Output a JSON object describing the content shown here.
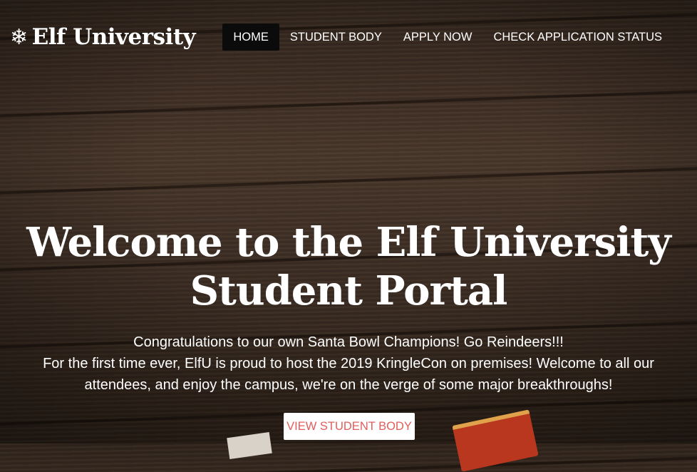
{
  "brand": {
    "icon": "snowflake-icon",
    "glyph": "❄",
    "name": "Elf University"
  },
  "nav": {
    "items": [
      {
        "label": "HOME",
        "active": true
      },
      {
        "label": "STUDENT BODY",
        "active": false
      },
      {
        "label": "APPLY NOW",
        "active": false
      },
      {
        "label": "CHECK APPLICATION STATUS",
        "active": false
      }
    ]
  },
  "hero": {
    "title_line1": "Welcome to the Elf University",
    "title_line2": "Student Portal",
    "line1": "Congratulations to our own Santa Bowl Champions! Go Reindeers!!!",
    "line2": "For the first time ever, ElfU is proud to host the 2019 KringleCon on premises! Welcome to all our attendees, and enjoy the campus, we're on the verge of some major breakthroughs!",
    "cta_label": "VIEW STUDENT BODY"
  },
  "colors": {
    "nav_active_bg": "#0b0b0b",
    "cta_text": "#e35d5b",
    "wood_background": "#3a2c22"
  }
}
